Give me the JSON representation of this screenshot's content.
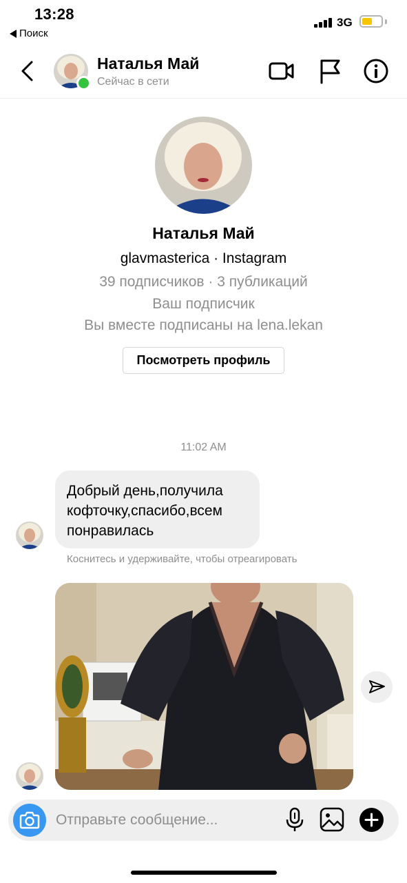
{
  "status_bar": {
    "time": "13:28",
    "back_app": "Поиск",
    "network": "3G",
    "battery_level": 0.55,
    "colors": {
      "battery": "#f7c600"
    }
  },
  "header": {
    "name": "Наталья Май",
    "status": "Сейчас в сети",
    "icons": [
      "back-chevron-icon",
      "video-call-icon",
      "flag-icon",
      "info-icon"
    ],
    "online_color": "#33c43e"
  },
  "profile": {
    "name": "Наталья Май",
    "handle": "glavmasterica · Instagram",
    "followers": "39 подписчиков · 3 публикаций",
    "follows_you": "Ваш подписчик",
    "mutual": "Вы вместе подписаны на lena.lekan",
    "view_profile_label": "Посмотреть профиль"
  },
  "thread": {
    "timestamp": "11:02 AM",
    "message": {
      "lines": [
        "Добрый день,получила",
        "кофточку,спасибо,всем",
        "понравилась"
      ]
    },
    "react_hint": "Коснитесь и удерживайте, чтобы отреагировать"
  },
  "composer": {
    "placeholder": "Отправьте сообщение...",
    "icons": [
      "camera-icon",
      "microphone-icon",
      "gallery-icon",
      "plus-icon"
    ],
    "accent": "#3897f0"
  }
}
